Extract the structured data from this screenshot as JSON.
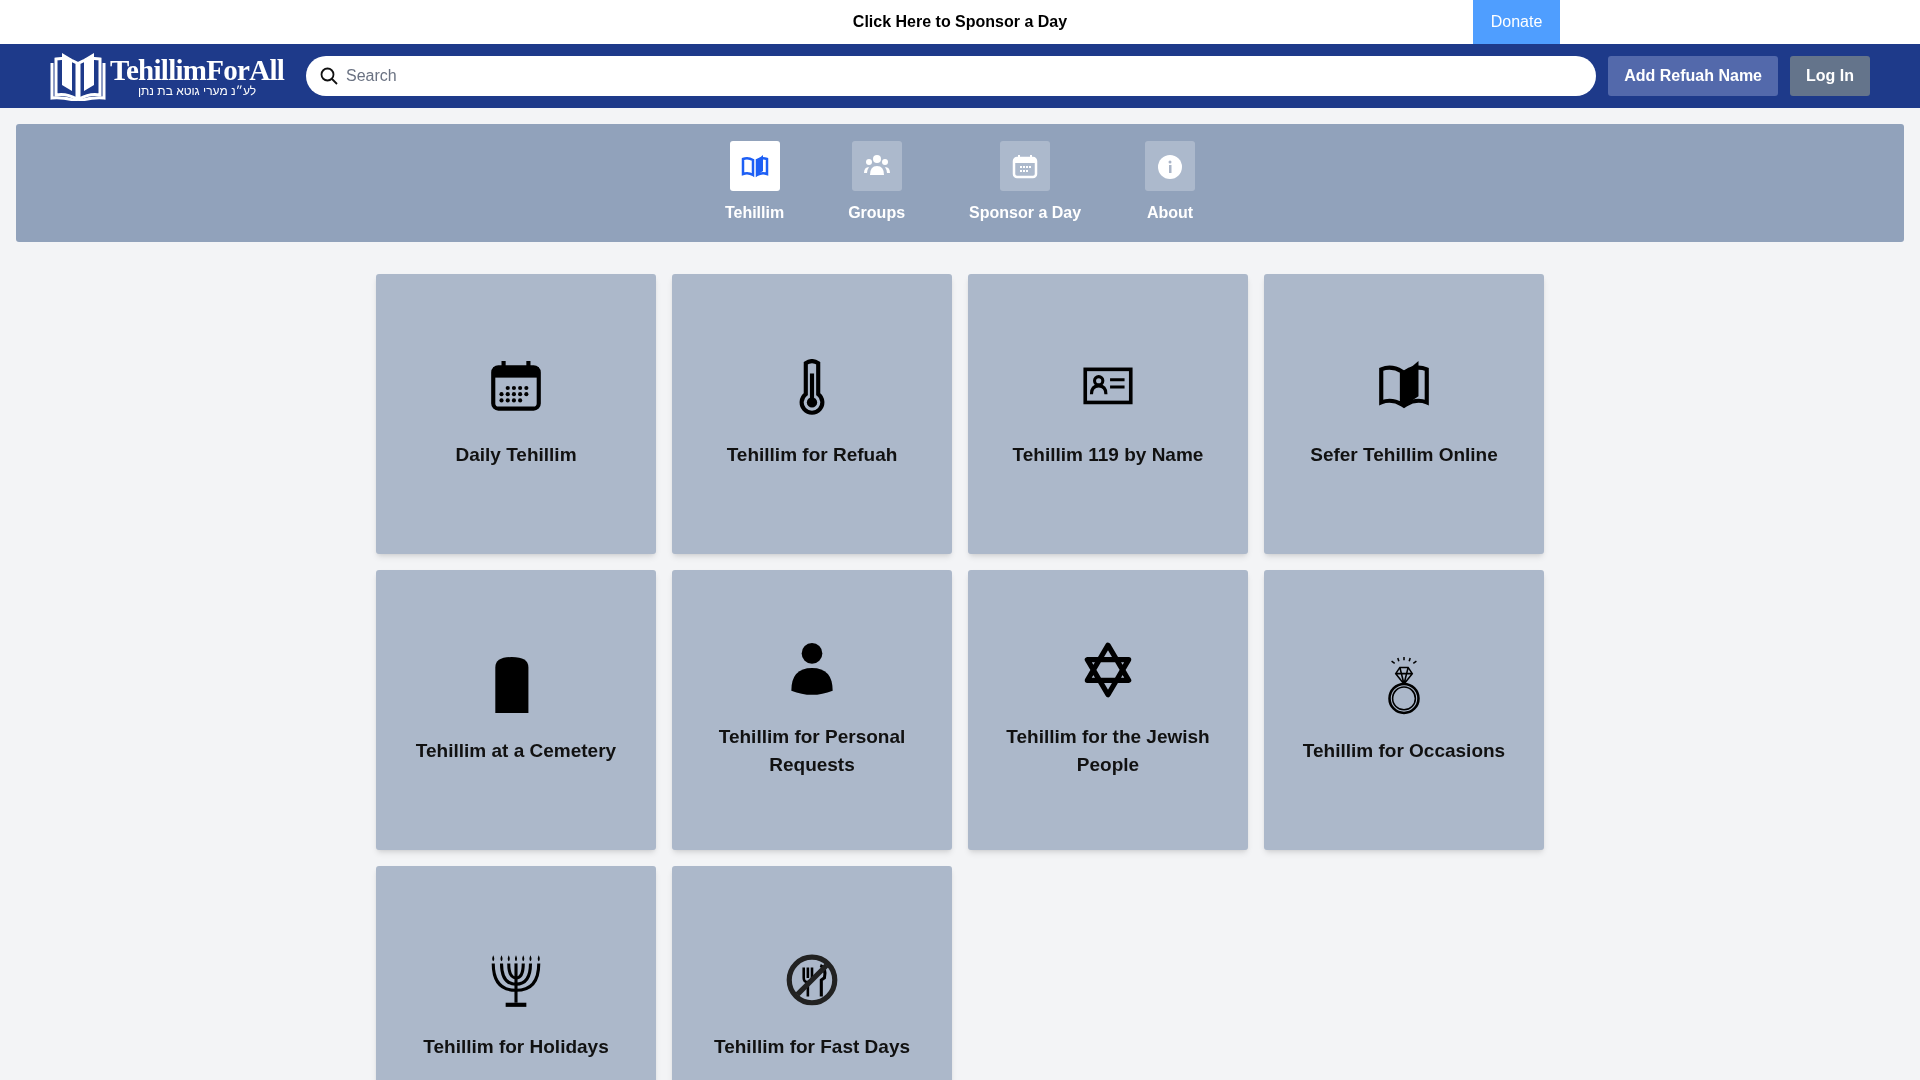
{
  "top_bar": {
    "sponsor_link": "Click Here to Sponsor a Day",
    "donate_button": "Donate"
  },
  "header": {
    "logo": {
      "title": "TehillimForAll",
      "dedication": "לע״נ מערי גוטא בת נתן"
    },
    "search": {
      "placeholder": "Search"
    },
    "buttons": [
      "Add Refuah Name",
      "Log In"
    ]
  },
  "tabs": [
    {
      "label": "Tehillim",
      "selected": true
    },
    {
      "label": "Groups",
      "selected": false
    },
    {
      "label": "Sponsor a Day",
      "selected": false
    },
    {
      "label": "About",
      "selected": false
    }
  ],
  "cards": [
    {
      "label": "Daily Tehillim"
    },
    {
      "label": "Tehillim for Refuah"
    },
    {
      "label": "Tehillim 119 by Name"
    },
    {
      "label": "Sefer Tehillim Online"
    },
    {
      "label": "Tehillim at a Cemetery"
    },
    {
      "label": "Tehillim for Personal Requests"
    },
    {
      "label": "Tehillim for the Jewish People"
    },
    {
      "label": "Tehillim for Occasions"
    },
    {
      "label": "Tehillim for Holidays"
    },
    {
      "label": "Tehillim for Fast Days"
    }
  ]
}
